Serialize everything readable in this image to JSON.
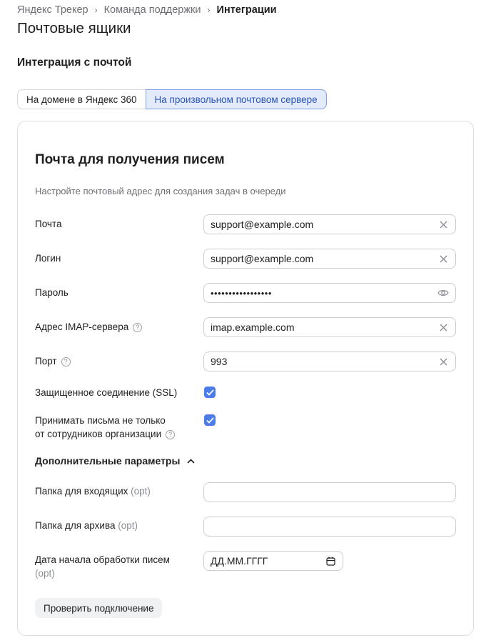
{
  "breadcrumb": {
    "items": [
      "Яндекс Трекер",
      "Команда поддержки"
    ],
    "current": "Интеграции"
  },
  "page_title": "Почтовые ящики",
  "section_title": "Интеграция с почтой",
  "tabs": [
    {
      "label": "На домене в Яндекс 360",
      "active": false
    },
    {
      "label": "На произвольном почтовом сервере",
      "active": true
    }
  ],
  "card": {
    "title": "Почта для получения писем",
    "description": "Настройте почтовый адрес для создания задач в очереди",
    "fields": {
      "mail": {
        "label": "Почта",
        "value": "support@example.com"
      },
      "login": {
        "label": "Логин",
        "value": "support@example.com"
      },
      "password": {
        "label": "Пароль",
        "value": "•••••••••••••••••"
      },
      "imap": {
        "label": "Адрес IMAP-сервера",
        "value": "imap.example.com"
      },
      "port": {
        "label": "Порт",
        "value": "993"
      }
    },
    "ssl": {
      "label": "Защищенное соединение (SSL)",
      "checked": true
    },
    "accept_external": {
      "label_line1": "Принимать письма не только",
      "label_line2": "от сотрудников организации",
      "checked": true
    },
    "advanced": {
      "title": "Дополнительные параметры",
      "expanded": true,
      "inbox_folder": {
        "label": "Папка для входящих",
        "opt": "(opt)",
        "value": ""
      },
      "archive_folder": {
        "label": "Папка для архива",
        "opt": "(opt)",
        "value": ""
      },
      "start_date": {
        "label": "Дата начала обработки писем",
        "opt": "(opt)",
        "placeholder": "ДД.ММ.ГГГГ"
      }
    },
    "check_button": "Проверить подключение"
  },
  "colors": {
    "accent": "#4c7ce8",
    "tab_active_bg": "#e3ebfb",
    "tab_active_text": "#2a54b8",
    "muted_text": "#6b6f75"
  }
}
